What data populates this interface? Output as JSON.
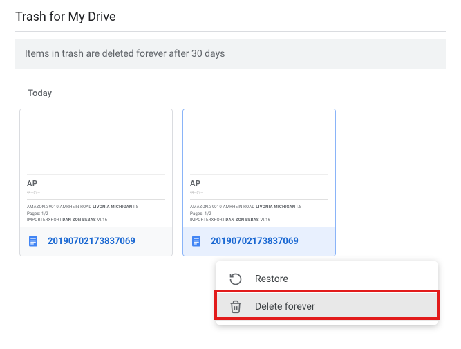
{
  "header": {
    "title": "Trash for My Drive"
  },
  "banner": {
    "text": "Items in trash are deleted forever after 30 days"
  },
  "section": {
    "label": "Today"
  },
  "preview": {
    "ap": "AP",
    "sub": "44—89—",
    "line1_a": "AMAZON.39010 AMRHEIN ROAD ",
    "line1_b": "LIVONIA MICHIGAN",
    "line1_c": " I.S",
    "line2": "Pages: 1/2",
    "line3_a": "IMPORTERXPORT.",
    "line3_b": "DAN ZON BEBAS",
    "line3_c": " VI.16"
  },
  "files": [
    {
      "name": "20190702173837069"
    },
    {
      "name": "20190702173837069"
    }
  ],
  "menu": {
    "restore": "Restore",
    "delete": "Delete forever"
  }
}
